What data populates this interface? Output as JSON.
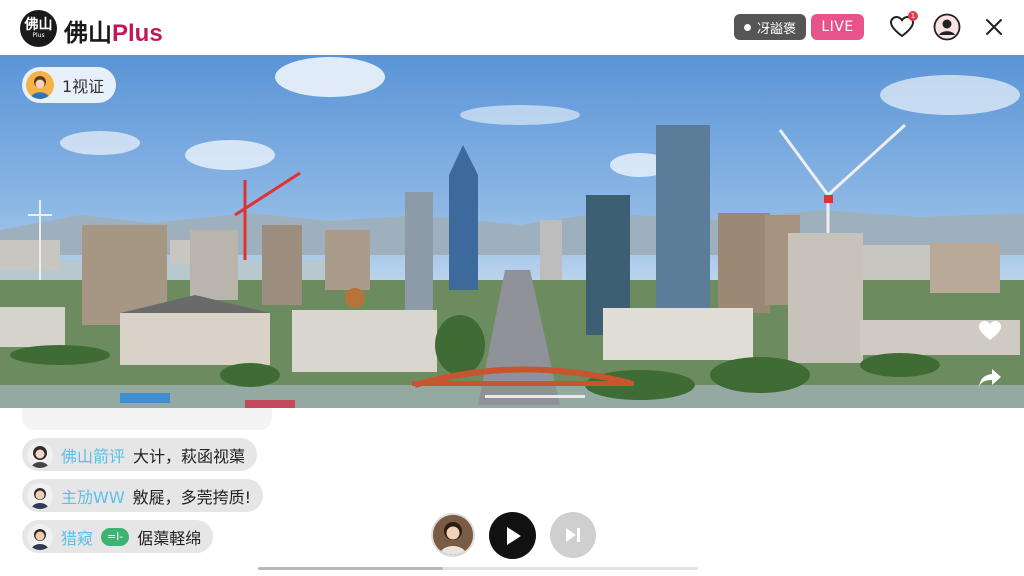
{
  "header": {
    "logo_main": "佛山",
    "logo_sub": "Plus",
    "brand_prefix": "佛山",
    "brand_plus": "Plus",
    "status_text": "冴謚褒",
    "live_label": "LIVE",
    "notif_count": "1"
  },
  "video": {
    "viewer_text": "1视证"
  },
  "chat": {
    "messages": [
      {
        "user": "佛山箭评",
        "text": "大计，萩函视蕖"
      },
      {
        "user": "主劢WW",
        "text": "敫屣，多莞挎质!"
      },
      {
        "user": "猎窥",
        "tag": "=l-",
        "text": "倨蕖軽绵"
      }
    ]
  },
  "player": {
    "progress": 0.42
  },
  "colors": {
    "accent": "#e8548a",
    "chat_user": "#5bbfe8",
    "tag": "#3cb371"
  }
}
